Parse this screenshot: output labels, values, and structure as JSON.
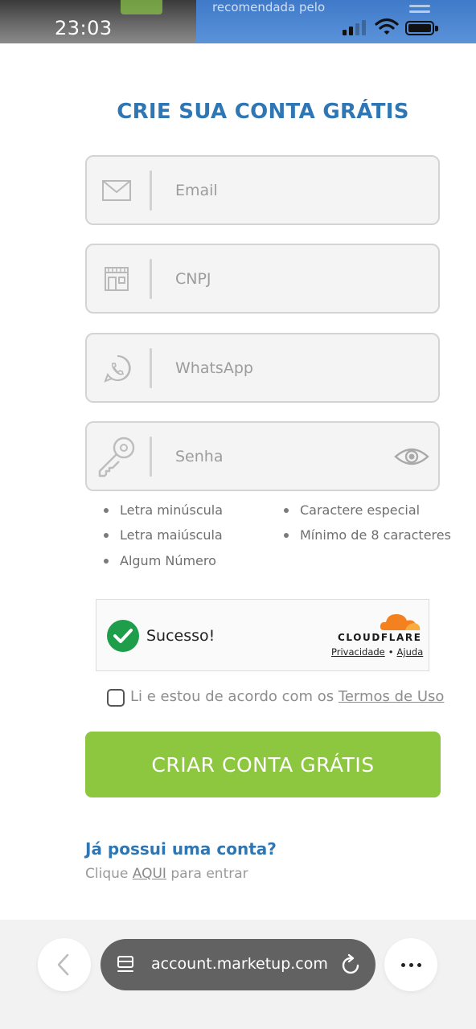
{
  "status_bar": {
    "time": "23:03",
    "behind_text": "recomendada pelo"
  },
  "form": {
    "title": "CRIE SUA CONTA GRÁTIS",
    "email": {
      "placeholder": "Email",
      "value": "",
      "icon": "envelope-icon"
    },
    "cnpj": {
      "placeholder": "CNPJ",
      "value": "",
      "icon": "store-icon"
    },
    "whatsapp": {
      "placeholder": "WhatsApp",
      "value": "",
      "icon": "whatsapp-icon"
    },
    "password": {
      "placeholder": "Senha",
      "value": "",
      "icon": "key-icon",
      "toggle_icon": "eye-icon"
    },
    "password_rules": {
      "lowercase": "Letra minúscula",
      "uppercase": "Letra maiúscula",
      "number": "Algum Número",
      "special": "Caractere especial",
      "min_length": "Mínimo de 8 caracteres"
    },
    "captcha": {
      "status": "Sucesso!",
      "brand": "CLOUDFLARE",
      "privacy": "Privacidade",
      "separator": "•",
      "help": "Ajuda"
    },
    "terms": {
      "prefix": "Li e estou de acordo com os ",
      "link": "Termos de Uso",
      "checked": false
    },
    "submit_label": "CRIAR CONTA GRÁTIS",
    "login": {
      "question": "Já possui uma conta?",
      "prefix": "Clique ",
      "link": "AQUI",
      "suffix": " para entrar"
    }
  },
  "browser": {
    "url": "account.marketup.com"
  },
  "colors": {
    "title_blue": "#2e77b4",
    "submit_green": "#8dc63f",
    "success_green": "#1e9e4a",
    "cloudflare_orange": "#f48120"
  }
}
